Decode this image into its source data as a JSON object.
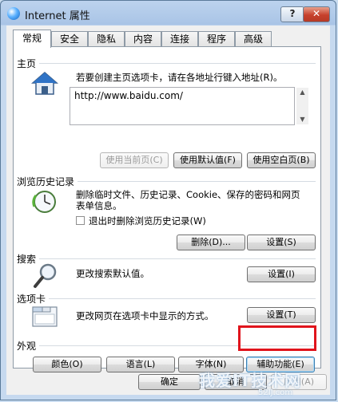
{
  "window": {
    "title": "Internet 属性",
    "help_label": "?",
    "close_label": "✕"
  },
  "tabs": [
    {
      "label": "常规"
    },
    {
      "label": "安全"
    },
    {
      "label": "隐私"
    },
    {
      "label": "内容"
    },
    {
      "label": "连接"
    },
    {
      "label": "程序"
    },
    {
      "label": "高级"
    }
  ],
  "home": {
    "title": "主页",
    "desc": "若要创建主页选项卡，请在各地址行键入地址(R)。",
    "url": "http://www.baidu.com/",
    "use_current": "使用当前页(C)",
    "use_default": "使用默认值(F)",
    "use_blank": "使用空白页(B)"
  },
  "history": {
    "title": "浏览历史记录",
    "desc_line1": "删除临时文件、历史记录、Cookie、保存的密码和网页",
    "desc_line2": "表单信息。",
    "checkbox_label": "退出时删除浏览历史记录(W)",
    "delete_label": "删除(D)...",
    "settings_label": "设置(S)"
  },
  "search": {
    "title": "搜索",
    "desc": "更改搜索默认值。",
    "settings_label": "设置(I)"
  },
  "tabs_section": {
    "title": "选项卡",
    "desc": "更改网页在选项卡中显示的方式。",
    "settings_label": "设置(T)"
  },
  "appearance": {
    "title": "外观",
    "colors_label": "颜色(O)",
    "languages_label": "语言(L)",
    "fonts_label": "字体(N)",
    "accessibility_label": "辅助功能(E)"
  },
  "footer": {
    "ok_label": "确定",
    "cancel_label": "取消",
    "apply_label": "应用(A)"
  },
  "watermark": {
    "text": "我爱IT技术网",
    "sub": "52IJ.com"
  },
  "colors": {
    "highlight": "#e0141c",
    "accent": "#3c7fb1"
  }
}
